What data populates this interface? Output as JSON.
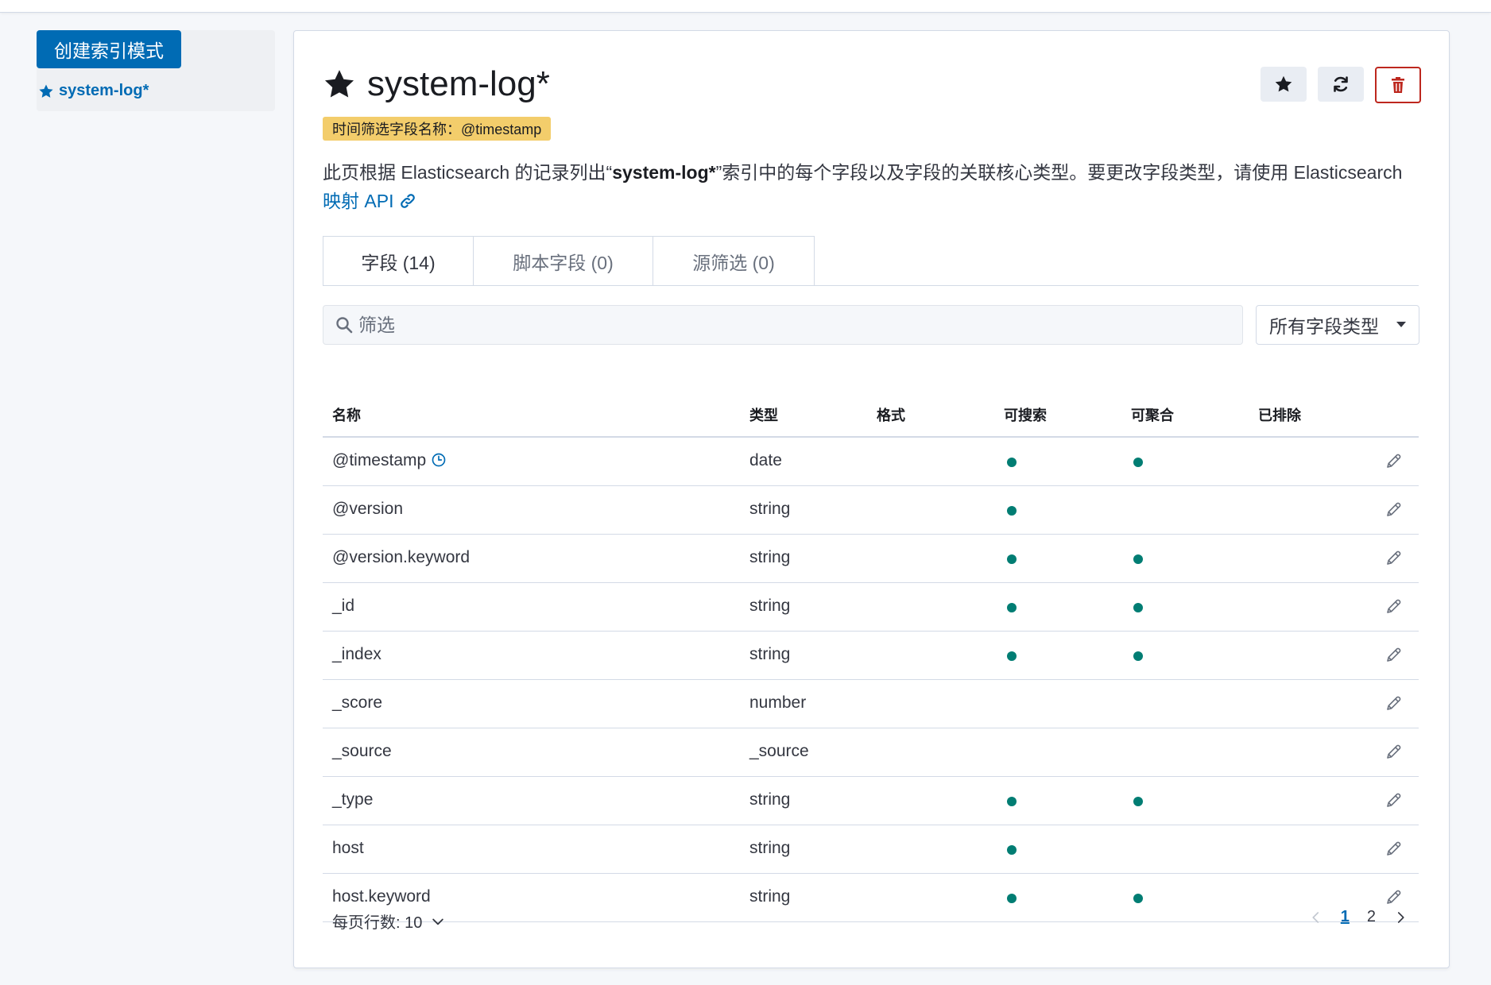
{
  "sidebar": {
    "create_button": "创建索引模式",
    "index_link": "system-log*"
  },
  "header": {
    "title": "system-log*",
    "time_field_badge": "时间筛选字段名称：@timestamp"
  },
  "description": {
    "part1": "此页根据 Elasticsearch 的记录列出“",
    "bold": "system-log*",
    "part2": "”索引中的每个字段以及字段的关联核心类型。要更改字段类型，请使用 Elasticsearch ",
    "link": "映射 API"
  },
  "tabs": [
    {
      "label": "字段 (14)"
    },
    {
      "label": "脚本字段 (0)"
    },
    {
      "label": "源筛选 (0)"
    }
  ],
  "filter": {
    "placeholder": "筛选",
    "type_select": "所有字段类型"
  },
  "table": {
    "headers": {
      "name": "名称",
      "type": "类型",
      "format": "格式",
      "searchable": "可搜索",
      "aggregatable": "可聚合",
      "excluded": "已排除"
    },
    "rows": [
      {
        "name": "@timestamp",
        "type": "date",
        "searchable": true,
        "aggregatable": true,
        "time": true
      },
      {
        "name": "@version",
        "type": "string",
        "searchable": true,
        "aggregatable": false
      },
      {
        "name": "@version.keyword",
        "type": "string",
        "searchable": true,
        "aggregatable": true
      },
      {
        "name": "_id",
        "type": "string",
        "searchable": true,
        "aggregatable": true
      },
      {
        "name": "_index",
        "type": "string",
        "searchable": true,
        "aggregatable": true
      },
      {
        "name": "_score",
        "type": "number",
        "searchable": false,
        "aggregatable": false
      },
      {
        "name": "_source",
        "type": "_source",
        "searchable": false,
        "aggregatable": false
      },
      {
        "name": "_type",
        "type": "string",
        "searchable": true,
        "aggregatable": true
      },
      {
        "name": "host",
        "type": "string",
        "searchable": true,
        "aggregatable": false
      },
      {
        "name": "host.keyword",
        "type": "string",
        "searchable": true,
        "aggregatable": true
      }
    ]
  },
  "pagination": {
    "rows_per_page": "每页行数: 10",
    "pages": [
      "1",
      "2"
    ],
    "current": "1"
  },
  "colors": {
    "primary": "#006bb4",
    "danger": "#bd271e",
    "dot": "#017d73",
    "badge": "#f3cd6b"
  }
}
